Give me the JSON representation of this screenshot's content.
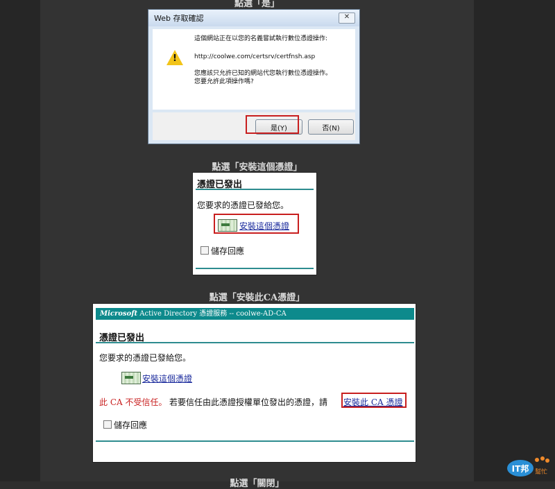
{
  "captions": {
    "top_partial": "點選「是」",
    "step_install_cert": "點選「安裝這個憑證」",
    "step_install_ca": "點選「安裝此CA憑證」",
    "bottom_partial": "點選「關閉」"
  },
  "dialog": {
    "title": "Web 存取確認",
    "close_label": "✕",
    "line1": "這個網站正在以您的名義嘗試執行數位憑證操作:",
    "url": "http://coolwe.com/certsrv/certfnsh.asp",
    "line2": "您應該只允許已知的網站代您執行數位憑證操作。",
    "line3": "您要允許此項操作嗎?",
    "yes_label": "是(Y)",
    "no_label": "否(N)"
  },
  "issued_box": {
    "heading": "憑證已發出",
    "message": "您要求的憑證已發給您。",
    "install_link": "安裝這個憑證",
    "save_response": "儲存回應"
  },
  "ca_box": {
    "banner_brand": "Microsoft",
    "banner_text": " Active Directory 憑證服務 -- coolwe-AD-CA",
    "heading": "憑證已發出",
    "message": "您要求的憑證已發給您。",
    "install_link": "安裝這個憑證",
    "untrusted": "此 CA 不受信任。",
    "trust_prompt": "若要信任由此憑證授權單位發出的憑證，請",
    "install_ca_link": "安裝此 CA 憑證",
    "save_response": "儲存回應"
  },
  "logo": {
    "brand": "IT邦",
    "sub": "幫忙"
  },
  "colors": {
    "highlight": "#c81e1e",
    "teal": "#0d8a8c",
    "link": "#1a2a9c"
  }
}
